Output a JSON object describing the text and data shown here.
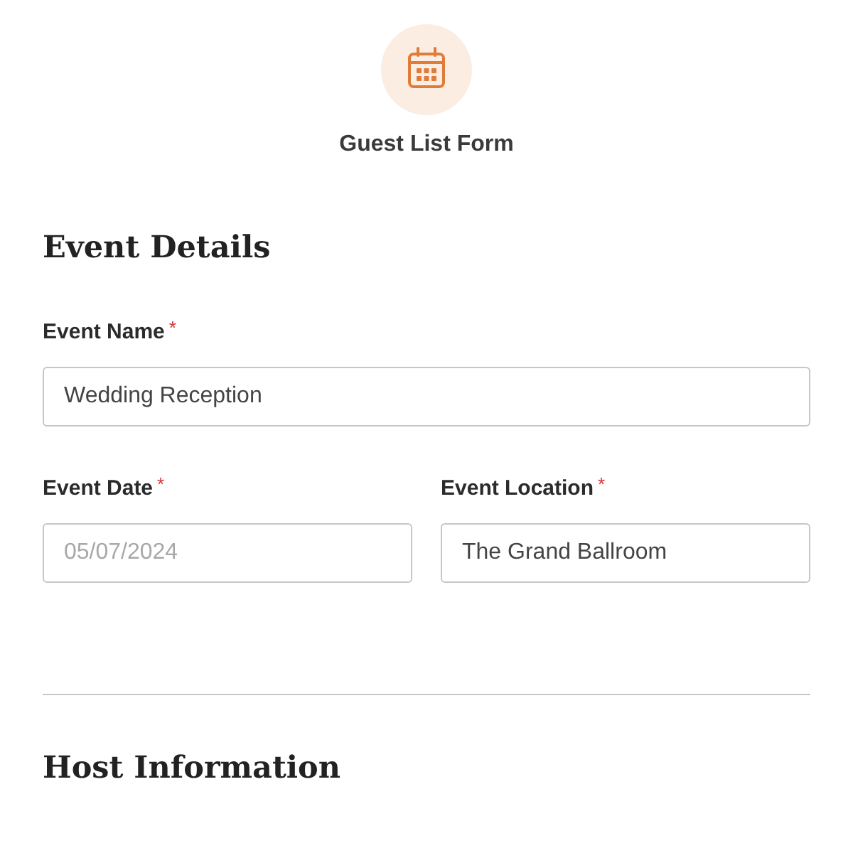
{
  "form": {
    "title": "Guest List Form"
  },
  "sections": [
    {
      "title": "Event Details",
      "rows": [
        {
          "fields": [
            {
              "label": "Event Name",
              "required_mark": "*",
              "value": "Wedding Reception"
            }
          ]
        },
        {
          "fields": [
            {
              "label": "Event Date",
              "required_mark": "*",
              "placeholder": "05/07/2024"
            },
            {
              "label": "Event Location",
              "required_mark": "*",
              "value": "The Grand Ballroom"
            }
          ]
        }
      ]
    },
    {
      "title": "Host Information"
    }
  ]
}
